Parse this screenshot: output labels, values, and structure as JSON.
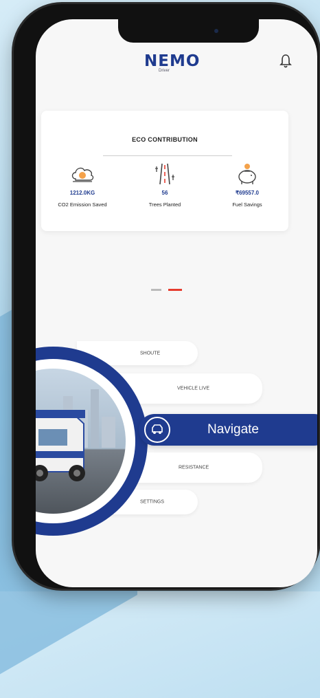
{
  "app": {
    "logo": "NEMO",
    "logo_sub": "Driver"
  },
  "eco": {
    "title": "ECO CONTRIBUTION",
    "stats": [
      {
        "value": "1212.0KG",
        "label": "CO2 Emission Saved",
        "icon": "co2-cloud-icon"
      },
      {
        "value": "56",
        "label": "Trees Planted",
        "icon": "road-trees-icon"
      },
      {
        "value": "₹69557.0",
        "label": "Fuel Savings",
        "icon": "piggy-bank-icon"
      }
    ]
  },
  "carousel": {
    "active_index": 1,
    "count": 2
  },
  "menu": {
    "items": [
      {
        "label": "SHOUTE"
      },
      {
        "label": "VEHICLE LIVE"
      },
      {
        "label": "RESISTANCE"
      },
      {
        "label": "SETTINGS"
      }
    ],
    "navigate_label": "Navigate"
  },
  "colors": {
    "brand": "#1f3b8f",
    "accent": "#e63b2e"
  }
}
